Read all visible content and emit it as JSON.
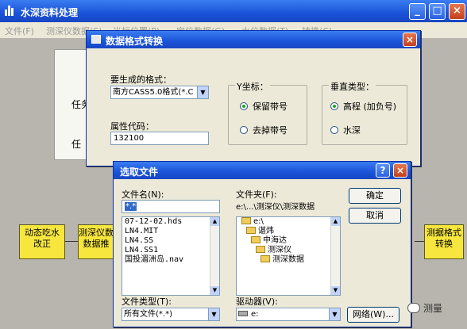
{
  "main_window": {
    "title": "水深资料处理",
    "menus": [
      "文件(F)",
      "测深仪数据(S)",
      "光标位置(P)",
      "定位数据(G)",
      "水位数据(T)",
      "转换(C)"
    ],
    "bg_labels": [
      "任务",
      "任"
    ],
    "flow_boxes": [
      {
        "line1": "动态吃水",
        "line2": "改正"
      },
      {
        "line1": "测深仪数",
        "line2": "数据推"
      },
      {
        "line1": "测据格式",
        "line2": "转换"
      }
    ]
  },
  "format_dialog": {
    "title": "数据格式转换",
    "output_format_label": "要生成的格式：",
    "output_format_value": "南方CASS5.0格式(*.C",
    "attr_code_label": "属性代码：",
    "attr_code_value": "132100",
    "y_coord_group": {
      "title": "Y坐标：",
      "options": [
        "保留带号",
        "去掉带号"
      ],
      "selected": 0
    },
    "vertical_group": {
      "title": "垂直类型：",
      "options": [
        "高程 (加负号)",
        "水深"
      ],
      "selected": 0
    }
  },
  "file_dialog": {
    "title": "选取文件",
    "filename_label": "文件名(N):",
    "filename_value": "*.*",
    "files": [
      "07-12-02.hds",
      "LN4.MIT",
      "LN4.SS",
      "LN4.SS1",
      "国投湄洲岛.nav"
    ],
    "folder_label": "文件夹(F):",
    "folder_path": "e:\\...\\测深仪\\测深数据",
    "folders": [
      "e:\\",
      "谌炜",
      "中海达",
      "测深仪",
      "测深数据"
    ],
    "ok_button": "确定",
    "cancel_button": "取消",
    "filetype_label": "文件类型(T):",
    "filetype_value": "所有文件(*.*)",
    "drive_label": "驱动器(V):",
    "drive_value": "e:",
    "network_button": "网络(W)..."
  },
  "watermark": "测量"
}
